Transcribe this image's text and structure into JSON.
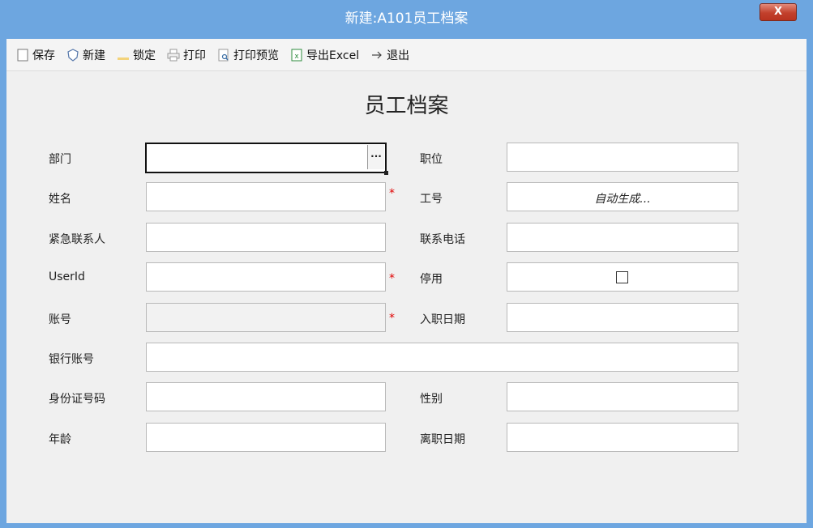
{
  "window": {
    "title": "新建:A101员工档案",
    "close_label": "X"
  },
  "toolbar": {
    "items": [
      {
        "label": "保存",
        "icon": "save-icon"
      },
      {
        "label": "新建",
        "icon": "new-icon"
      },
      {
        "label": "锁定",
        "icon": "lock-icon"
      },
      {
        "label": "打印",
        "icon": "print-icon"
      },
      {
        "label": "打印预览",
        "icon": "print-preview-icon"
      },
      {
        "label": "导出Excel",
        "icon": "excel-icon"
      },
      {
        "label": "退出",
        "icon": "exit-icon"
      }
    ]
  },
  "form": {
    "title": "员工档案",
    "required_mark": "*",
    "fields": {
      "department": {
        "label": "部门",
        "value": ""
      },
      "position": {
        "label": "职位",
        "value": ""
      },
      "name": {
        "label": "姓名",
        "value": ""
      },
      "employee_no": {
        "label": "工号",
        "value": "",
        "placeholder": "自动生成..."
      },
      "emergency_contact": {
        "label": "紧急联系人",
        "value": ""
      },
      "phone": {
        "label": "联系电话",
        "value": ""
      },
      "userid": {
        "label": "UserId",
        "value": ""
      },
      "disabled": {
        "label": "停用",
        "checked": false
      },
      "account": {
        "label": "账号",
        "value": ""
      },
      "hire_date": {
        "label": "入职日期",
        "value": ""
      },
      "bank_account": {
        "label": "银行账号",
        "value": ""
      },
      "id_number": {
        "label": "身份证号码",
        "value": ""
      },
      "gender": {
        "label": "性别",
        "value": ""
      },
      "age": {
        "label": "年龄",
        "value": ""
      },
      "leave_date": {
        "label": "离职日期",
        "value": ""
      }
    }
  }
}
